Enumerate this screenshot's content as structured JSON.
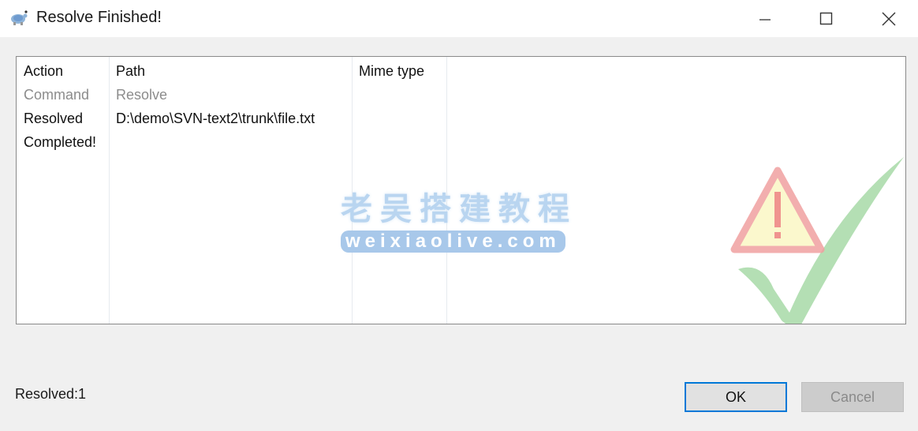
{
  "window": {
    "title": "Resolve Finished!",
    "app_icon": "tortoise-svn-icon",
    "controls": {
      "minimize": "minimize-icon",
      "maximize": "maximize-icon",
      "close": "close-icon"
    }
  },
  "list": {
    "columns": [
      "Action",
      "Path",
      "Mime type"
    ],
    "rows": [
      {
        "action": "Command",
        "path": "Resolve",
        "mime": "",
        "style": "gray"
      },
      {
        "action": "Resolved",
        "path": "D:\\demo\\SVN-text2\\trunk\\file.txt",
        "mime": "",
        "style": "black"
      },
      {
        "action": "Completed!",
        "path": "",
        "mime": "",
        "style": "black"
      }
    ],
    "background_icon": "warning-check-icon"
  },
  "watermark": {
    "line1": "老吴搭建教程",
    "line2": "weixiaolive.com"
  },
  "footer": {
    "status": "Resolved:1",
    "ok_label": "OK",
    "cancel_label": "Cancel"
  },
  "colors": {
    "accent": "#0078d7",
    "background": "#f0f0f0"
  }
}
